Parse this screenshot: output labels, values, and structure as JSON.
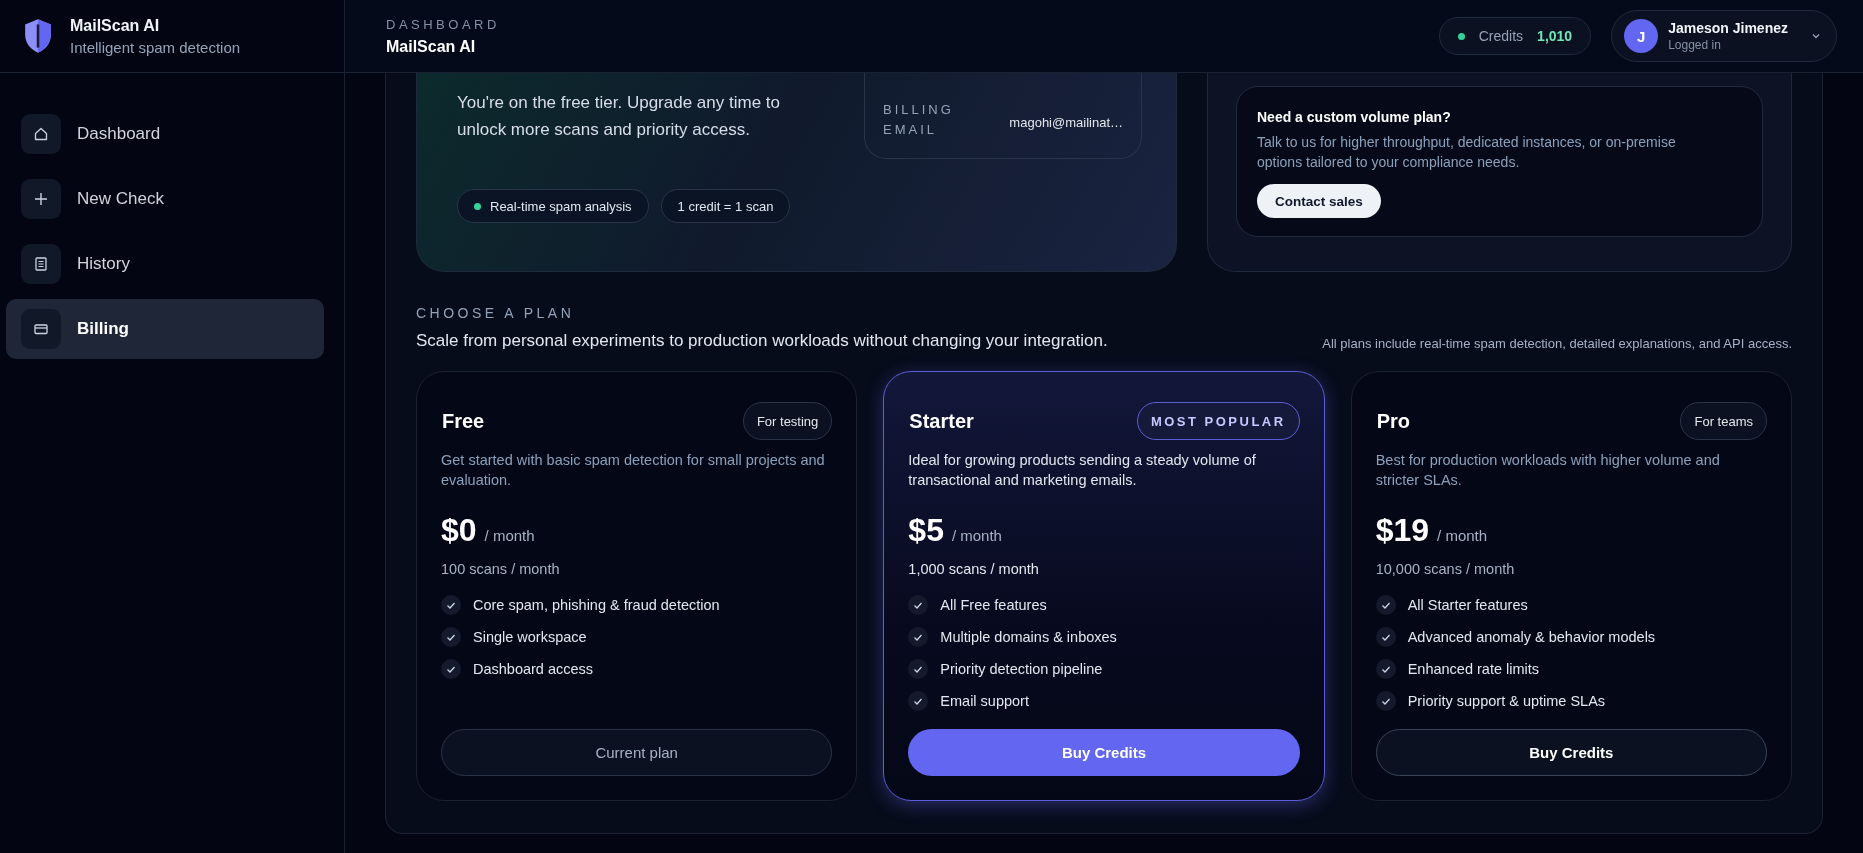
{
  "brand": {
    "name": "MailScan AI",
    "tagline": "Intelligent spam detection"
  },
  "sidebar": {
    "items": [
      {
        "label": "Dashboard",
        "kind": "home",
        "selected": false
      },
      {
        "label": "New Check",
        "kind": "add",
        "selected": false
      },
      {
        "label": "History",
        "kind": "log",
        "selected": false
      },
      {
        "label": "Billing",
        "kind": "payment",
        "selected": true
      }
    ]
  },
  "header": {
    "eyebrow": "DASHBOARD",
    "title": "MailScan AI",
    "credits_label": "Credits",
    "credits_value": "1,010",
    "user": {
      "initial": "J",
      "name": "Jameson Jimenez",
      "status": "Logged in"
    }
  },
  "current_plan": {
    "text": "You're on the free tier. Upgrade any time to unlock more scans and priority access.",
    "billing_email_label": "BILLING EMAIL",
    "billing_email": "magohi@mailinat…",
    "chips": [
      {
        "label": "Real-time spam analysis",
        "dot": true
      },
      {
        "label": "1 credit = 1 scan",
        "dot": false
      }
    ]
  },
  "custom_plan": {
    "title": "Need a custom volume plan?",
    "text": "Talk to us for higher throughput, dedicated instances, or on-premise options tailored to your compliance needs.",
    "button": "Contact sales"
  },
  "plans_section": {
    "eyebrow": "CHOOSE A PLAN",
    "subtitle": "Scale from personal experiments to production workloads without changing your integration.",
    "note": "All plans include real-time spam detection, detailed explanations, and API access."
  },
  "plans": [
    {
      "name": "Free",
      "badge": "For testing",
      "featured": false,
      "description": "Get started with basic spam detection for small projects and evaluation.",
      "price": "$0",
      "period": "/ month",
      "scans": "100 scans / month",
      "features": [
        "Core spam, phishing & fraud detection",
        "Single workspace",
        "Dashboard access"
      ],
      "button": {
        "label": "Current plan",
        "kind": "current"
      }
    },
    {
      "name": "Starter",
      "badge": "MOST POPULAR",
      "featured": true,
      "description": "Ideal for growing products sending a steady volume of transactional and marketing emails.",
      "price": "$5",
      "period": "/ month",
      "scans": "1,000 scans / month",
      "features": [
        "All Free features",
        "Multiple domains & inboxes",
        "Priority detection pipeline",
        "Email support"
      ],
      "button": {
        "label": "Buy Credits",
        "kind": "primary"
      }
    },
    {
      "name": "Pro",
      "badge": "For teams",
      "featured": false,
      "description": "Best for production workloads with higher volume and stricter SLAs.",
      "price": "$19",
      "period": "/ month",
      "scans": "10,000 scans / month",
      "features": [
        "All Starter features",
        "Advanced anomaly & behavior models",
        "Enhanced rate limits",
        "Priority support & uptime SLAs"
      ],
      "button": {
        "label": "Buy Credits",
        "kind": "outline"
      }
    }
  ]
}
